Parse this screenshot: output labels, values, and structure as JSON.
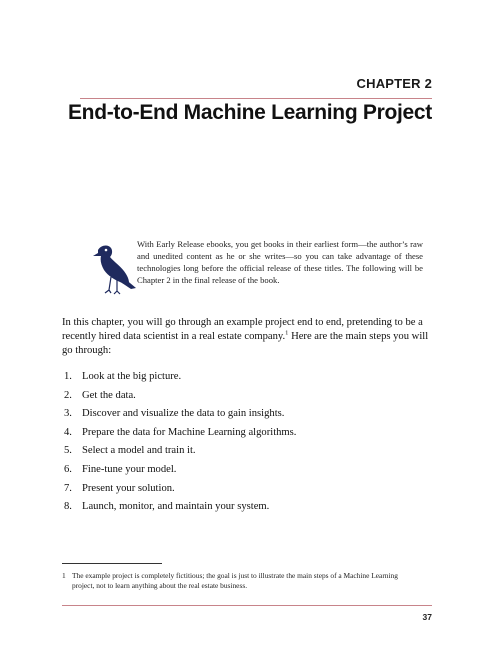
{
  "chapter": {
    "label": "CHAPTER 2",
    "title": "End-to-End Machine Learning Project"
  },
  "notice": {
    "icon": "bird-icon",
    "text": "With Early Release ebooks, you get books in their earliest form—the author’s raw and unedited content as he or she writes—so you can take advantage of these technologies long before the official release of these titles. The following will be Chapter 2 in the final release of the book."
  },
  "intro": {
    "text_before": "In this chapter, you will go through an example project end to end, pretending to be a recently hired data scientist in a real estate company.",
    "footnote_ref": "1",
    "text_after": " Here are the main steps you will go through:"
  },
  "steps": [
    {
      "num": "1.",
      "text": "Look at the big picture."
    },
    {
      "num": "2.",
      "text": "Get the data."
    },
    {
      "num": "3.",
      "text": "Discover and visualize the data to gain insights."
    },
    {
      "num": "4.",
      "text": "Prepare the data for Machine Learning algorithms."
    },
    {
      "num": "5.",
      "text": "Select a model and train it."
    },
    {
      "num": "6.",
      "text": "Fine-tune your model."
    },
    {
      "num": "7.",
      "text": "Present your solution."
    },
    {
      "num": "8.",
      "text": "Launch, monitor, and maintain your system."
    }
  ],
  "footnote": {
    "num": "1",
    "line1": "The example project is completely fictitious; the goal is just to illustrate the main steps of a Machine Learning",
    "line2": "project, not to learn anything about the real estate business."
  },
  "page_number": "37",
  "colors": {
    "rule": "#c8848a",
    "bird": "#1f2a5e"
  }
}
